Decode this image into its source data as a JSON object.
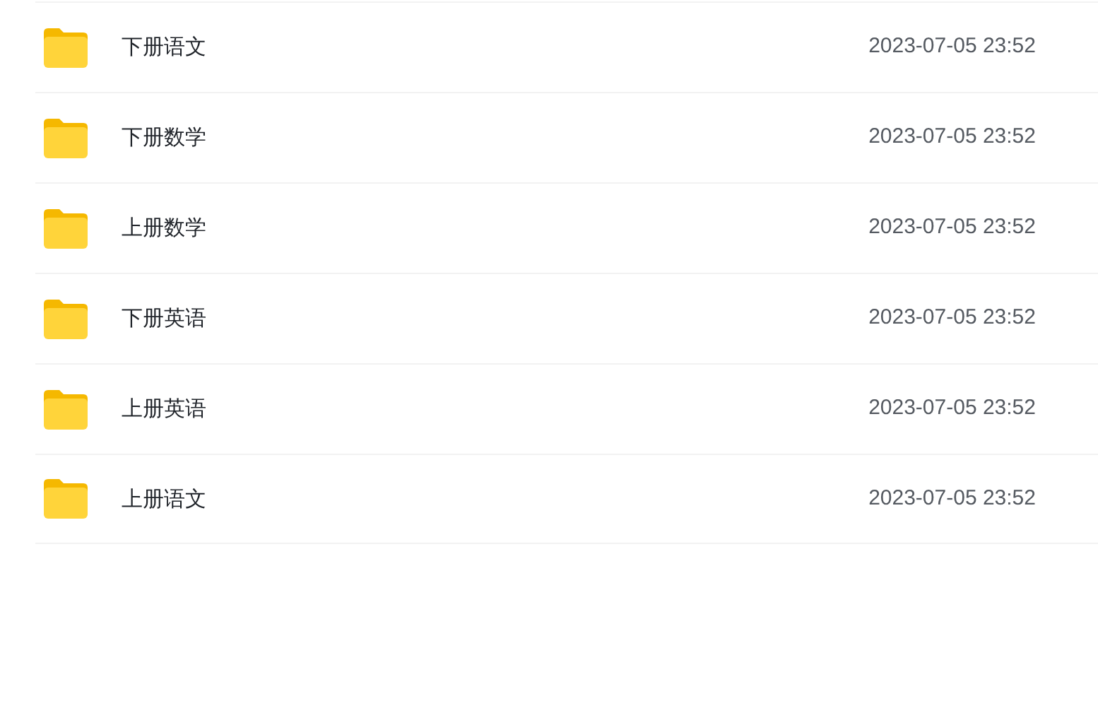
{
  "files": [
    {
      "name": "下册语文",
      "modified": "2023-07-05 23:52"
    },
    {
      "name": "下册数学",
      "modified": "2023-07-05 23:52"
    },
    {
      "name": "上册数学",
      "modified": "2023-07-05 23:52"
    },
    {
      "name": "下册英语",
      "modified": "2023-07-05 23:52"
    },
    {
      "name": "上册英语",
      "modified": "2023-07-05 23:52"
    },
    {
      "name": "上册语文",
      "modified": "2023-07-05 23:52"
    }
  ]
}
